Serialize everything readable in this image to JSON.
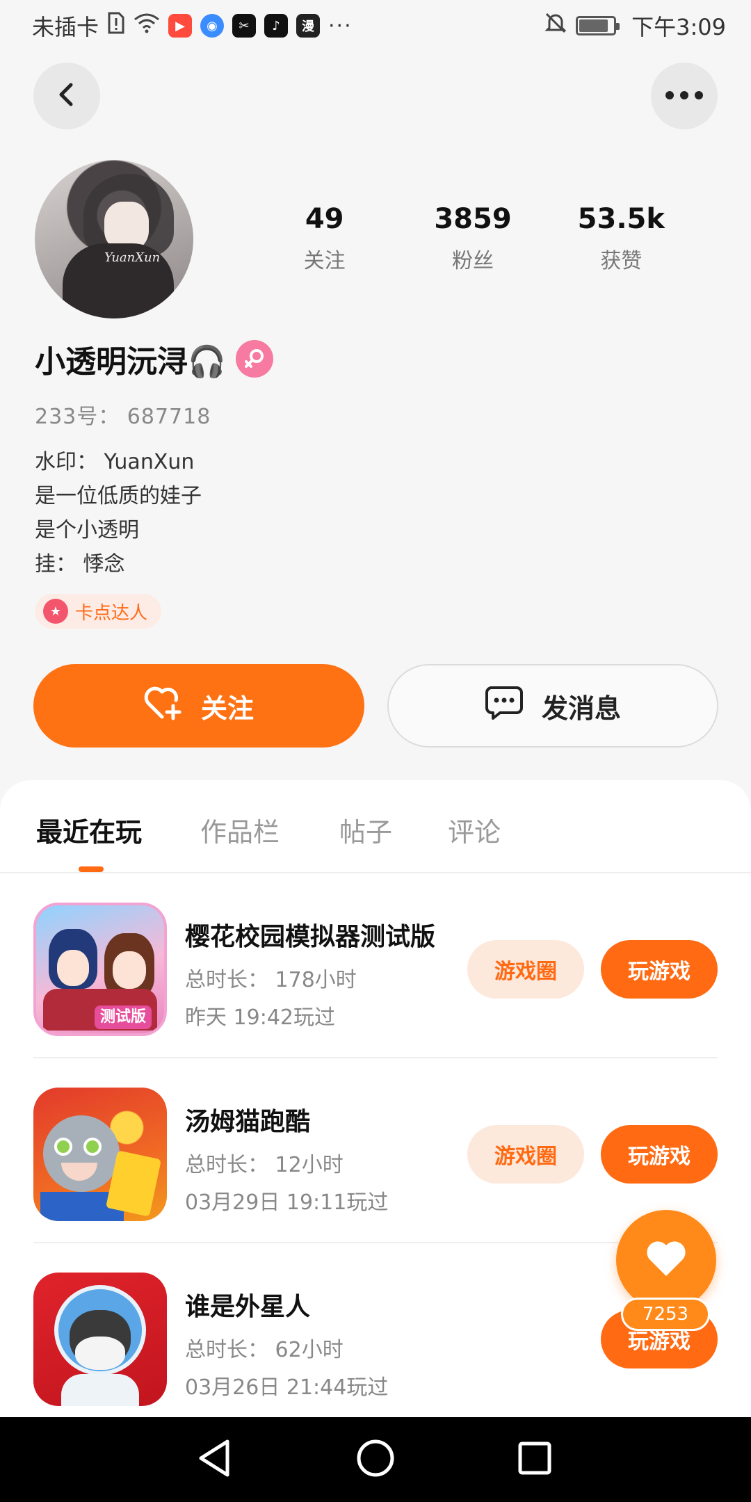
{
  "status_bar": {
    "carrier": "未插卡",
    "time": "下午3:09",
    "app_icons": [
      "sim-alert-icon",
      "wifi-icon",
      "kuaishou-icon",
      "browser-icon",
      "capcut-icon",
      "tiktok-icon",
      "dongman-icon"
    ],
    "more": "···"
  },
  "profile": {
    "avatar_signature": "YuanXun",
    "stats": [
      {
        "value": "49",
        "label": "关注"
      },
      {
        "value": "3859",
        "label": "粉丝"
      },
      {
        "value": "53.5k",
        "label": "获赞"
      }
    ],
    "username": "小透明沅浔🎧",
    "gender": "female",
    "uid": "233号： 687718",
    "bio": [
      "水印： YuanXun",
      "是一位低质的娃子",
      "是个小透明",
      "挂： 悸念"
    ],
    "tag": "卡点达人"
  },
  "actions": {
    "follow": "关注",
    "message": "发消息"
  },
  "tabs": [
    "最近在玩",
    "作品栏",
    "帖子",
    "评论"
  ],
  "games": [
    {
      "name": "樱花校园模拟器测试版",
      "duration": "总时长： 178小时",
      "last_played": "昨天 19:42玩过",
      "circle_label": "游戏圈",
      "play_label": "玩游戏",
      "icon_badge": "测试版"
    },
    {
      "name": "汤姆猫跑酷",
      "duration": "总时长： 12小时",
      "last_played": "03月29日 19:11玩过",
      "circle_label": "游戏圈",
      "play_label": "玩游戏"
    },
    {
      "name": "谁是外星人",
      "duration": "总时长： 62小时",
      "last_played": "03月26日 21:44玩过",
      "play_label": "玩游戏"
    }
  ],
  "like_fab": {
    "count": "7253"
  },
  "colors": {
    "accent": "#ff7214",
    "accent_light": "#fde8dc",
    "gender": "#f77aa0"
  }
}
